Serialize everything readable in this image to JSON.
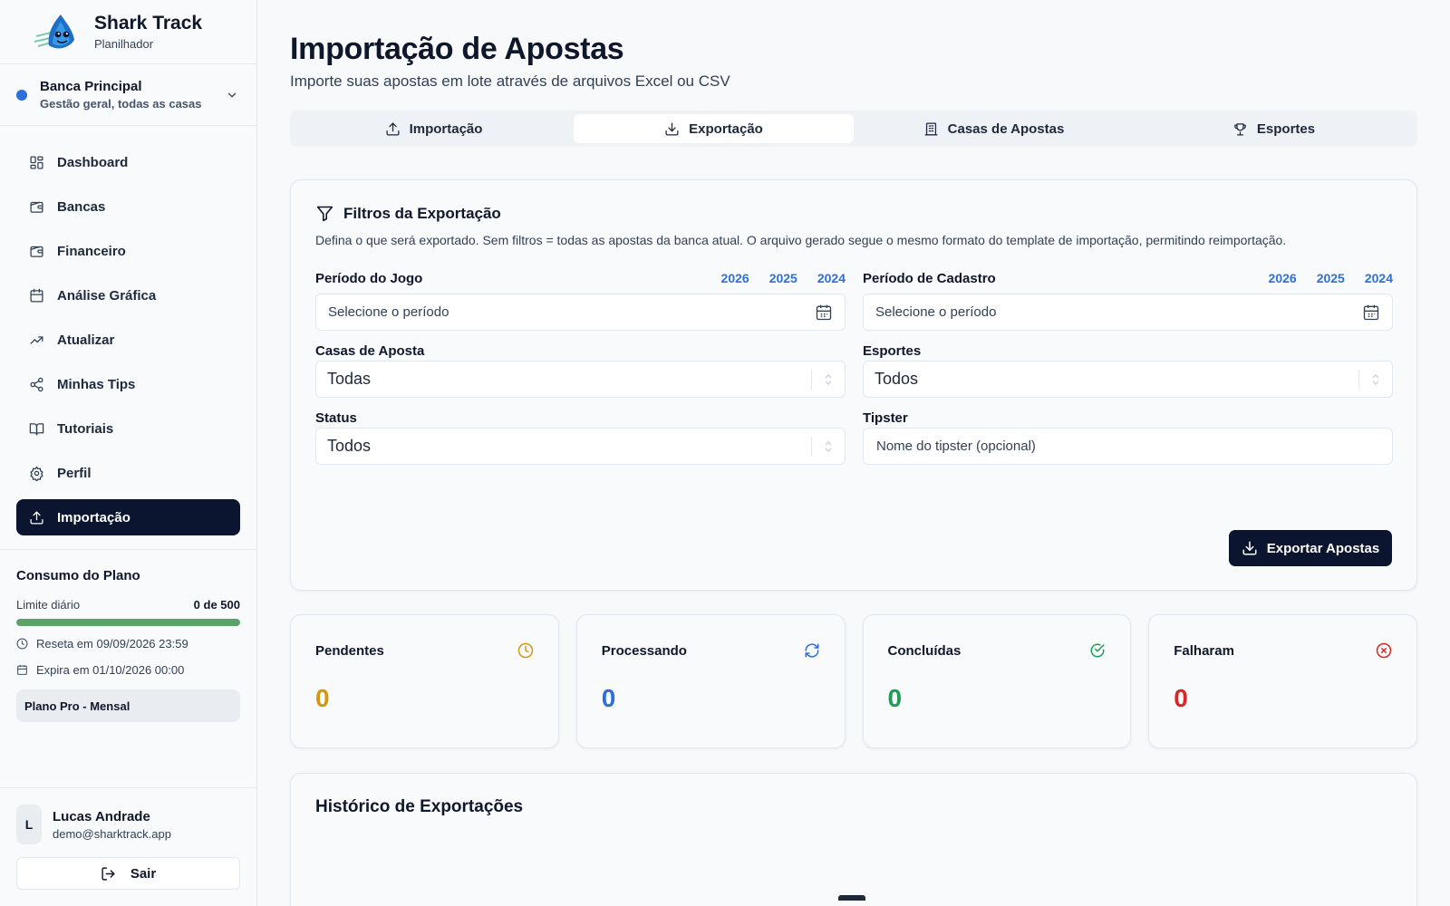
{
  "brand": {
    "name": "Shark Track",
    "subtitle": "Planilhador"
  },
  "bank": {
    "name": "Banca Principal",
    "description": "Gestão geral, todas as casas",
    "dot_color": "#2f6fdb"
  },
  "nav": {
    "items": [
      {
        "label": "Dashboard",
        "icon": "grid-icon"
      },
      {
        "label": "Bancas",
        "icon": "wallet-icon"
      },
      {
        "label": "Financeiro",
        "icon": "wallet-icon"
      },
      {
        "label": "Análise Gráfica",
        "icon": "calendar-icon"
      },
      {
        "label": "Atualizar",
        "icon": "trending-up-icon"
      },
      {
        "label": "Minhas Tips",
        "icon": "share-icon"
      },
      {
        "label": "Tutoriais",
        "icon": "book-icon"
      },
      {
        "label": "Perfil",
        "icon": "gear-icon"
      },
      {
        "label": "Importação",
        "icon": "upload-icon",
        "active": true
      }
    ]
  },
  "plan": {
    "title": "Consumo do Plano",
    "limit_label": "Limite diário",
    "limit_value": "0 de 500",
    "progress": 1.0,
    "progress_color": "#5aa469",
    "reset": "Reseta em 09/09/2026 23:59",
    "expires": "Expira em 01/10/2026 00:00",
    "badge": "Plano Pro - Mensal"
  },
  "user": {
    "initial": "L",
    "name": "Lucas Andrade",
    "email": "demo@sharktrack.app",
    "logout_label": "Sair"
  },
  "header": {
    "title": "Importação de Apostas",
    "subtitle": "Importe suas apostas em lote através de arquivos Excel ou CSV"
  },
  "tabs": [
    {
      "label": "Importação",
      "icon": "upload-icon"
    },
    {
      "label": "Exportação",
      "icon": "download-icon",
      "active": true
    },
    {
      "label": "Casas de Apostas",
      "icon": "building-icon"
    },
    {
      "label": "Esportes",
      "icon": "trophy-icon"
    }
  ],
  "filters": {
    "title": "Filtros da Exportação",
    "description": "Defina o que será exportado. Sem filtros = todas as apostas da banca atual. O arquivo gerado segue o mesmo formato do template de importação, permitindo reimportação.",
    "game_period": {
      "label": "Período do Jogo",
      "placeholder": "Selecione o período",
      "years": [
        "2026",
        "2025",
        "2024"
      ]
    },
    "register_period": {
      "label": "Período de Cadastro",
      "placeholder": "Selecione o período",
      "years": [
        "2026",
        "2025",
        "2024"
      ]
    },
    "houses": {
      "label": "Casas de Aposta",
      "value": "Todas"
    },
    "sports": {
      "label": "Esportes",
      "value": "Todos"
    },
    "status": {
      "label": "Status",
      "value": "Todos"
    },
    "tipster": {
      "label": "Tipster",
      "placeholder": "Nome do tipster (opcional)"
    },
    "export_label": "Exportar Apostas"
  },
  "stats": [
    {
      "label": "Pendentes",
      "value": "0",
      "color": "#d4970f",
      "icon": "clock-icon"
    },
    {
      "label": "Processando",
      "value": "0",
      "color": "#2f6fdb",
      "icon": "refresh-icon"
    },
    {
      "label": "Concluídas",
      "value": "0",
      "color": "#1f9d55",
      "icon": "check-circle-icon"
    },
    {
      "label": "Falharam",
      "value": "0",
      "color": "#dc2626",
      "icon": "x-circle-icon"
    }
  ],
  "history": {
    "title": "Histórico de Exportações"
  }
}
